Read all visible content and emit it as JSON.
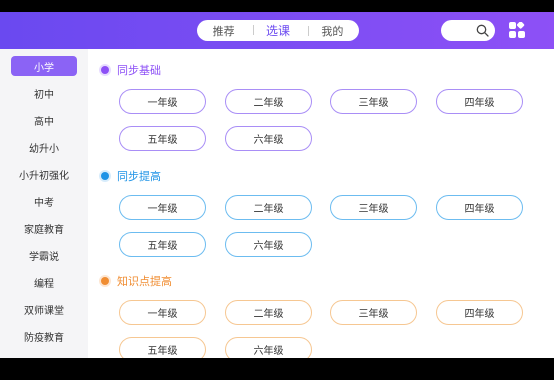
{
  "header": {
    "tabs": [
      {
        "label": "推荐"
      },
      {
        "label": "选课"
      },
      {
        "label": "我的"
      }
    ],
    "active_tab": "选课"
  },
  "sidebar": {
    "items": [
      {
        "label": "小学"
      },
      {
        "label": "初中"
      },
      {
        "label": "高中"
      },
      {
        "label": "幼升小"
      },
      {
        "label": "小升初强化"
      },
      {
        "label": "中考"
      },
      {
        "label": "家庭教育"
      },
      {
        "label": "学霸说"
      },
      {
        "label": "编程"
      },
      {
        "label": "双师课堂"
      },
      {
        "label": "防疫教育"
      }
    ],
    "active": "小学"
  },
  "sections": [
    {
      "title": "同步基础",
      "color": "#8d50f6",
      "grades": [
        "一年级",
        "二年级",
        "三年级",
        "四年级",
        "五年级",
        "六年级"
      ]
    },
    {
      "title": "同步提高",
      "color": "#1d93e6",
      "grades": [
        "一年级",
        "二年级",
        "三年级",
        "四年级",
        "五年级",
        "六年级"
      ]
    },
    {
      "title": "知识点提高",
      "color": "#f08d32",
      "grades": [
        "一年级",
        "二年级",
        "三年级",
        "四年级",
        "五年级",
        "六年级"
      ]
    }
  ]
}
